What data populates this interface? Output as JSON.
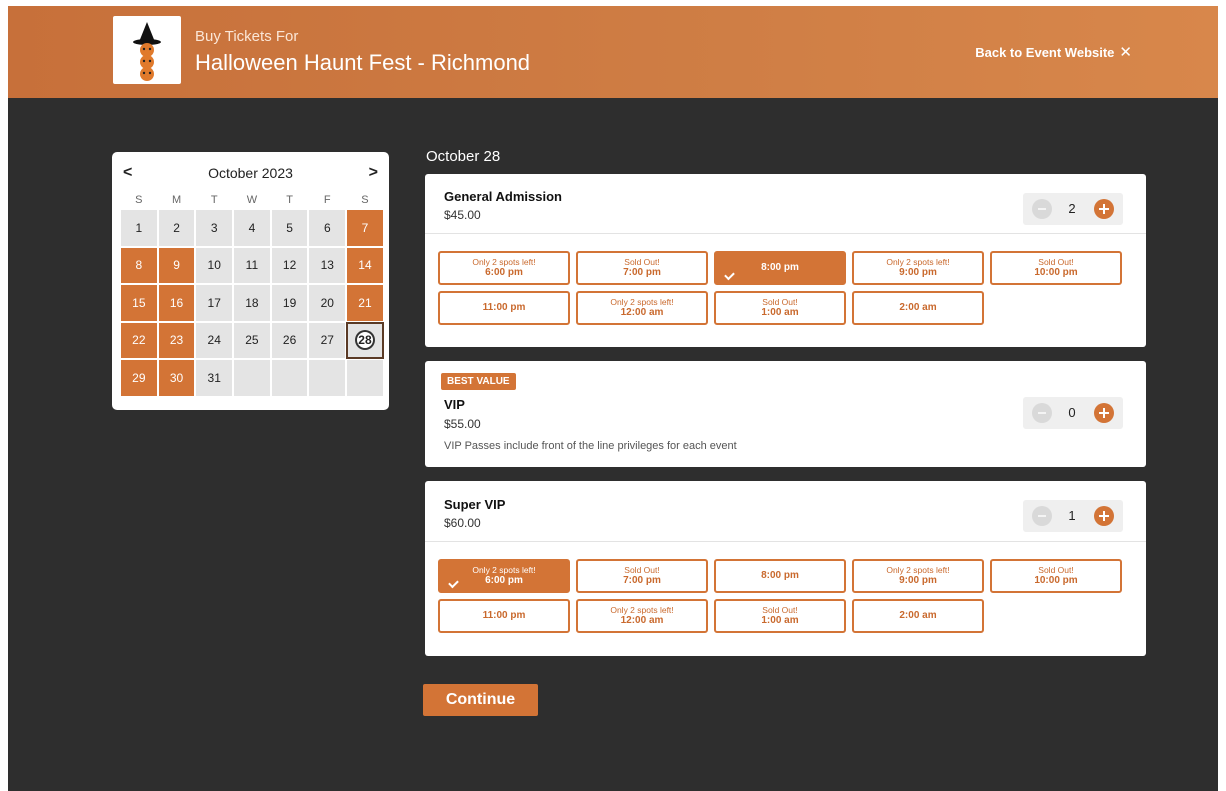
{
  "header": {
    "kicker": "Buy Tickets For",
    "title": "Halloween Haunt Fest - Richmond",
    "back_label": "Back to Event Website",
    "back_icon": "close-icon",
    "logo_icon": "witch-pumpkin-logo"
  },
  "calendar": {
    "month_label": "October 2023",
    "prev_icon": "chevron-left-icon",
    "next_icon": "chevron-right-icon",
    "weekdays": [
      "S",
      "M",
      "T",
      "W",
      "T",
      "F",
      "S"
    ],
    "days": [
      {
        "label": "1",
        "state": "available"
      },
      {
        "label": "2",
        "state": "available"
      },
      {
        "label": "3",
        "state": "available"
      },
      {
        "label": "4",
        "state": "available"
      },
      {
        "label": "5",
        "state": "available"
      },
      {
        "label": "6",
        "state": "available"
      },
      {
        "label": "7",
        "state": "sold"
      },
      {
        "label": "8",
        "state": "sold"
      },
      {
        "label": "9",
        "state": "sold"
      },
      {
        "label": "10",
        "state": "available"
      },
      {
        "label": "11",
        "state": "available"
      },
      {
        "label": "12",
        "state": "available"
      },
      {
        "label": "13",
        "state": "available"
      },
      {
        "label": "14",
        "state": "sold"
      },
      {
        "label": "15",
        "state": "sold"
      },
      {
        "label": "16",
        "state": "sold"
      },
      {
        "label": "17",
        "state": "available"
      },
      {
        "label": "18",
        "state": "available"
      },
      {
        "label": "19",
        "state": "available"
      },
      {
        "label": "20",
        "state": "available"
      },
      {
        "label": "21",
        "state": "sold"
      },
      {
        "label": "22",
        "state": "sold"
      },
      {
        "label": "23",
        "state": "sold"
      },
      {
        "label": "24",
        "state": "available"
      },
      {
        "label": "25",
        "state": "available"
      },
      {
        "label": "26",
        "state": "available"
      },
      {
        "label": "27",
        "state": "available"
      },
      {
        "label": "28",
        "state": "selected"
      },
      {
        "label": "29",
        "state": "sold"
      },
      {
        "label": "30",
        "state": "sold"
      },
      {
        "label": "31",
        "state": "available"
      },
      {
        "label": "",
        "state": "empty"
      },
      {
        "label": "",
        "state": "empty"
      },
      {
        "label": "",
        "state": "empty"
      },
      {
        "label": "",
        "state": "empty"
      }
    ]
  },
  "selected_date": "October 28",
  "tickets": [
    {
      "name": "General Admission",
      "price": "$45.00",
      "quantity": "2",
      "slots": [
        {
          "note": "Only 2 spots left!",
          "time": "6:00 pm",
          "selected": false
        },
        {
          "note": "Sold Out!",
          "time": "7:00 pm",
          "selected": false
        },
        {
          "note": "",
          "time": "8:00 pm",
          "selected": true
        },
        {
          "note": "Only 2 spots left!",
          "time": "9:00 pm",
          "selected": false
        },
        {
          "note": "Sold Out!",
          "time": "10:00 pm",
          "selected": false
        },
        {
          "note": "",
          "time": "11:00 pm",
          "selected": false
        },
        {
          "note": "Only 2 spots left!",
          "time": "12:00 am",
          "selected": false
        },
        {
          "note": "Sold Out!",
          "time": "1:00 am",
          "selected": false
        },
        {
          "note": "",
          "time": "2:00 am",
          "selected": false
        }
      ]
    },
    {
      "badge": "BEST VALUE",
      "name": "VIP",
      "price": "$55.00",
      "description": "VIP Passes include front of the line privileges for each event",
      "quantity": "0"
    },
    {
      "name": "Super VIP",
      "price": "$60.00",
      "quantity": "1",
      "slots": [
        {
          "note": "Only 2 spots left!",
          "time": "6:00 pm",
          "selected": true
        },
        {
          "note": "Sold Out!",
          "time": "7:00 pm",
          "selected": false
        },
        {
          "note": "",
          "time": "8:00 pm",
          "selected": false
        },
        {
          "note": "Only 2 spots left!",
          "time": "9:00 pm",
          "selected": false
        },
        {
          "note": "Sold Out!",
          "time": "10:00 pm",
          "selected": false
        },
        {
          "note": "",
          "time": "11:00 pm",
          "selected": false
        },
        {
          "note": "Only 2 spots left!",
          "time": "12:00 am",
          "selected": false
        },
        {
          "note": "Sold Out!",
          "time": "1:00 am",
          "selected": false
        },
        {
          "note": "",
          "time": "2:00 am",
          "selected": false
        }
      ]
    }
  ],
  "continue_label": "Continue",
  "colors": {
    "accent": "#d37436",
    "background": "#2e2e2e",
    "header_start": "#c7703a",
    "header_end": "#d8874b"
  }
}
